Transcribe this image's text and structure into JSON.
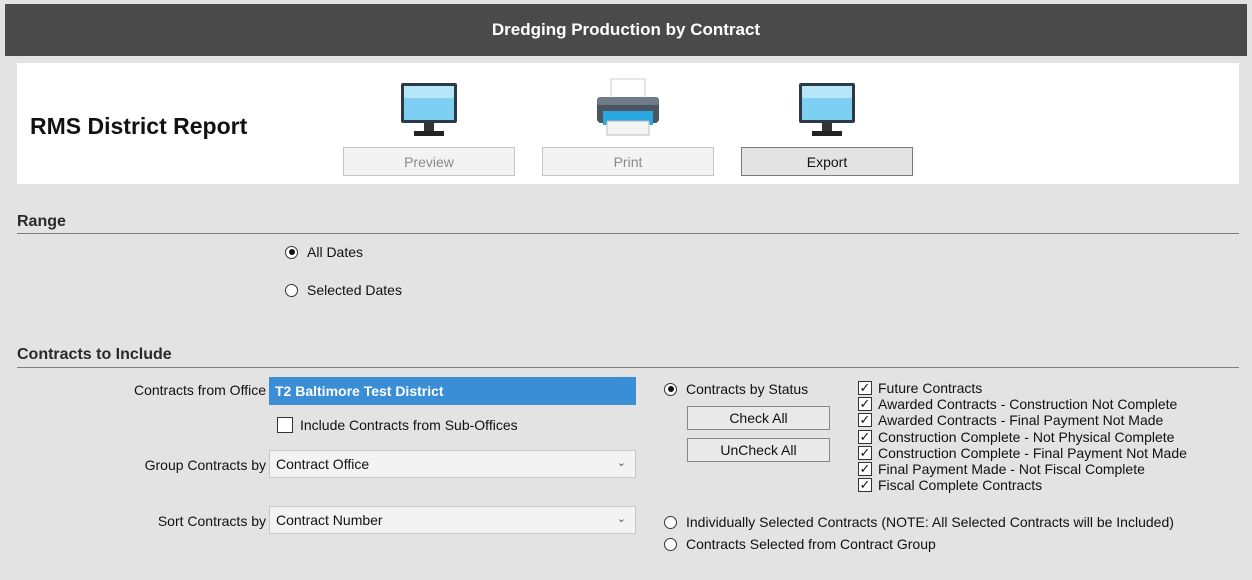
{
  "window": {
    "title": "Dredging Production by Contract"
  },
  "header": {
    "report_title": "RMS District Report",
    "tools": [
      {
        "label": "Preview",
        "icon": "monitor-icon",
        "enabled": false
      },
      {
        "label": "Print",
        "icon": "printer-icon",
        "enabled": false
      },
      {
        "label": "Export",
        "icon": "monitor-icon",
        "enabled": true
      }
    ]
  },
  "range": {
    "heading": "Range",
    "options": [
      {
        "label": "All Dates",
        "selected": true
      },
      {
        "label": "Selected Dates",
        "selected": false
      }
    ]
  },
  "contracts": {
    "heading": "Contracts to Include",
    "office_label": "Contracts from Office",
    "office_value": "T2 Baltimore Test District",
    "sub_offices_label": "Include Contracts from Sub-Offices",
    "sub_offices_checked": false,
    "group_label": "Group Contracts by",
    "group_value": "Contract Office",
    "sort_label": "Sort Contracts by",
    "sort_value": "Contract Number",
    "mode_options": [
      {
        "label": "Contracts by Status",
        "selected": true
      },
      {
        "label": "Individually Selected Contracts (NOTE: All Selected Contracts will be Included)",
        "selected": false
      },
      {
        "label": "Contracts Selected from Contract Group",
        "selected": false
      }
    ],
    "check_all_label": "Check All",
    "uncheck_all_label": "UnCheck All",
    "statuses": [
      {
        "label": "Future Contracts",
        "checked": true
      },
      {
        "label": "Awarded Contracts - Construction Not Complete",
        "checked": true
      },
      {
        "label": "Awarded Contracts - Final Payment Not Made",
        "checked": true
      },
      {
        "label": "Construction Complete - Not Physical Complete",
        "checked": true
      },
      {
        "label": "Construction Complete - Final Payment Not Made",
        "checked": true
      },
      {
        "label": "Final Payment Made - Not Fiscal Complete",
        "checked": true
      },
      {
        "label": "Fiscal Complete Contracts",
        "checked": true
      }
    ]
  }
}
